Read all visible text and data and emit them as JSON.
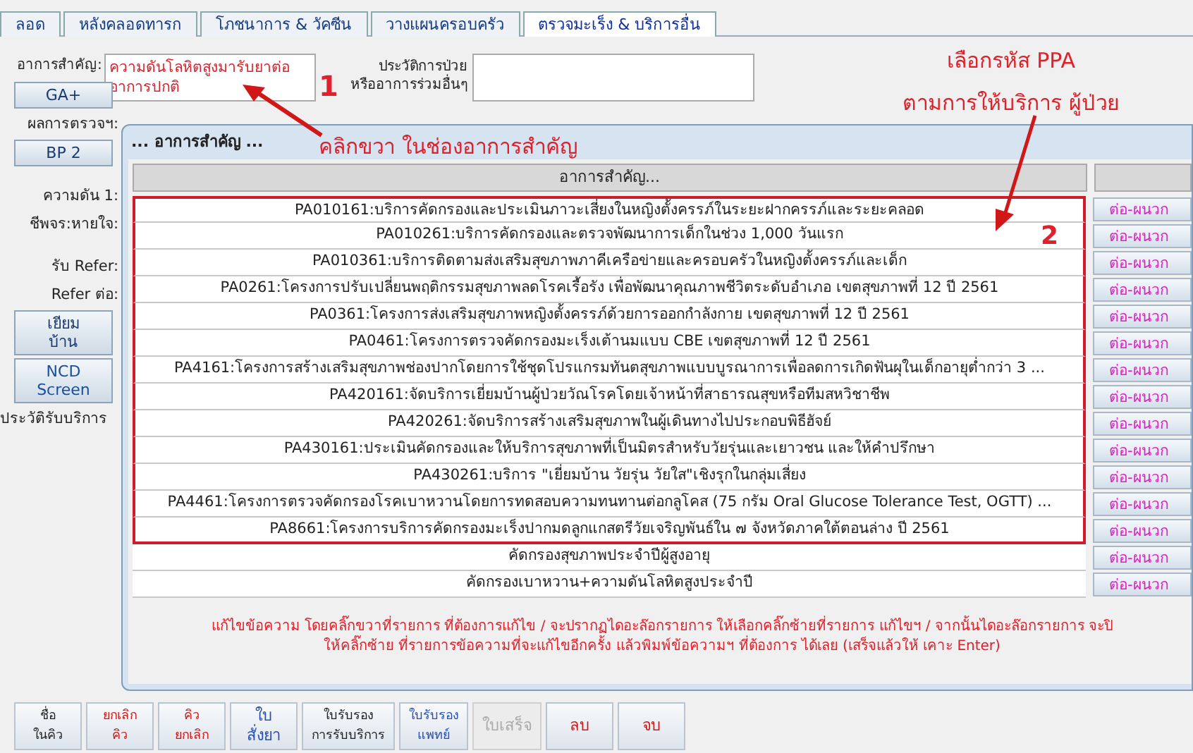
{
  "tabs": [
    {
      "label": "ลอด",
      "selected": false
    },
    {
      "label": "หลังคลอดทารก",
      "selected": false
    },
    {
      "label": "โภชนาการ & วัคซีน",
      "selected": false
    },
    {
      "label": "วางแผนครอบครัว",
      "selected": false
    },
    {
      "label": "ตรวจมะเร็ง & บริการอื่น",
      "selected": true
    }
  ],
  "chief_complaint": {
    "label": "อาการสำคัญ:",
    "value_lines": [
      "ความดันโลหิตสูงมารับยาต่อ",
      "อาการปกติ"
    ]
  },
  "history": {
    "label_lines": [
      "ประวัติการป่วย",
      "หรืออาการร่วมอื่นๆ"
    ]
  },
  "left_panel": [
    {
      "kind": "button",
      "lines": [
        "GA+"
      ]
    },
    {
      "kind": "label",
      "lines": [
        "ผลการตรวจฯ:"
      ]
    },
    {
      "kind": "button",
      "lines": [
        "BP 2"
      ]
    },
    {
      "kind": "label",
      "lines": [
        "ความดัน 1:"
      ]
    },
    {
      "kind": "label",
      "lines": [
        "ชีพจร:หายใจ:"
      ]
    },
    {
      "kind": "label",
      "lines": [
        "รับ Refer:"
      ]
    },
    {
      "kind": "label",
      "lines": [
        "Refer ต่อ:"
      ]
    },
    {
      "kind": "button",
      "lines": [
        "เยียม",
        "บ้าน"
      ]
    },
    {
      "kind": "blue_button",
      "lines": [
        "NCD",
        "Screen"
      ]
    },
    {
      "kind": "label",
      "lines": [
        "ประวัติรับบริการ"
      ]
    }
  ],
  "dialog": {
    "title": "... อาการสำคัญ ...",
    "column_header": "อาการสำคัญ...",
    "rows": [
      {
        "text": "PA010161:บริการคัดกรองและประเมินภาวะเสี่ยงในหญิงตั้งครรภ์ในระยะฝากครรภ์และระยะคลอด",
        "action": "ต่อ-ผนวก",
        "outlined": true
      },
      {
        "text": "PA010261:บริการคัดกรองและตรวจพัฒนาการเด็กในช่วง 1,000 วันแรก",
        "action": "ต่อ-ผนวก",
        "outlined": true
      },
      {
        "text": "PA010361:บริการติดตามส่งเสริมสุขภาพภาคีเครือข่ายและครอบครัวในหญิงตั้งครรภ์และเด็ก",
        "action": "ต่อ-ผนวก",
        "outlined": true
      },
      {
        "text": "PA0261:โครงการปรับเปลี่ยนพฤติกรรมสุขภาพลดโรคเรื้อรัง เพื่อพัฒนาคุณภาพชีวิตระดับอำเภอ เขตสุขภาพที่ 12 ปี 2561",
        "action": "ต่อ-ผนวก",
        "outlined": true
      },
      {
        "text": "PA0361:โครงการส่งเสริมสุขภาพหญิงตั้งครรภ์ด้วยการออกกำลังกาย เขตสุขภาพที่ 12 ปี 2561",
        "action": "ต่อ-ผนวก",
        "outlined": true
      },
      {
        "text": "PA0461:โครงการตรวจคัดกรองมะเร็งเต้านมแบบ CBE เขตสุขภาพที่ 12 ปี 2561",
        "action": "ต่อ-ผนวก",
        "outlined": true
      },
      {
        "text": "PA4161:โครงการสร้างเสริมสุขภาพช่องปากโดยการใช้ชุดโปรแกรมทันตสุขภาพแบบบูรณาการเพื่อลดการเกิดฟันผุในเด็กอายุต่ำกว่า 3 ...",
        "action": "ต่อ-ผนวก",
        "outlined": true
      },
      {
        "text": "PA420161:จัดบริการเยี่ยมบ้านผู้ป่วยวัณโรคโดยเจ้าหน้าที่สาธารณสุขหรือทีมสหวิชาชีพ",
        "action": "ต่อ-ผนวก",
        "outlined": true
      },
      {
        "text": "PA420261:จัดบริการสร้างเสริมสุขภาพในผู้เดินทางไปประกอบพิธีฮัจย์",
        "action": "ต่อ-ผนวก",
        "outlined": true
      },
      {
        "text": "PA430161:ประเมินคัดกรองและให้บริการสุขภาพที่เป็นมิตรสำหรับวัยรุ่นและเยาวชน และให้คำปรึกษา",
        "action": "ต่อ-ผนวก",
        "outlined": true
      },
      {
        "text": "PA430261:บริการ \"เยี่ยมบ้าน วัยรุ่น วัยใส\"เชิงรุกในกลุ่มเสี่ยง",
        "action": "ต่อ-ผนวก",
        "outlined": true
      },
      {
        "text": "PA4461:โครงการตรวจคัดกรองโรคเบาหวานโดยการทดสอบความทนทานต่อกลูโคส (75 กรัม Oral Glucose Tolerance Test, OGTT) ...",
        "action": "ต่อ-ผนวก",
        "outlined": true
      },
      {
        "text": "PA8661:โครงการบริการคัดกรองมะเร็งปากมดลูกแกสตรีวัยเจริญพันธ์ใน ๗ จังหวัดภาคใต้ตอนล่าง ปี 2561",
        "action": "ต่อ-ผนวก",
        "outlined": true
      },
      {
        "text": "คัดกรองสุขภาพประจำปีผู้สูงอายุ",
        "action": "ต่อ-ผนวก",
        "outlined": false
      },
      {
        "text": "คัดกรองเบาหวาน+ความดันโลหิตสูงประจำปี",
        "action": "ต่อ-ผนวก",
        "outlined": false
      }
    ],
    "instructions": [
      "แก้ไขข้อความ โดยคลิ๊กขวาที่รายการ ที่ต้องการแก้ไข / จะปรากฏไดอะล๊อกรายการ ให้เลือกคลิ๊กซ้ายที่รายการ แก้ไขฯ / จากนั้นไดอะล๊อกรายการ จะปิ",
      "ให้คลิ๊กซ้าย ที่รายการข้อความที่จะแก้ไขอีกครั้ง แล้วพิมพ์ข้อความฯ ที่ต้องการ ได้เลย (เสร็จแล้วให้ เคาะ Enter)"
    ]
  },
  "bottom_buttons": [
    {
      "lines": [
        "ชื่อ",
        "ในคิว"
      ],
      "color": "#222222",
      "disabled": false
    },
    {
      "lines": [
        "ยกเลิก",
        "คิว"
      ],
      "color": "#d01818",
      "disabled": false
    },
    {
      "lines": [
        "คิว",
        "ยกเลิก"
      ],
      "color": "#d01818",
      "disabled": false
    },
    {
      "lines": [
        "ใบ",
        "สั่งยา"
      ],
      "color": "#2a4fb0",
      "disabled": false
    },
    {
      "lines": [
        "ใบรับรอง",
        "การรับบริการ"
      ],
      "color": "#222222",
      "disabled": false
    },
    {
      "lines": [
        "ใบรับรอง",
        "แพทย์"
      ],
      "color": "#2a4fb0",
      "disabled": false
    },
    {
      "lines": [
        "ใบเสร็จ"
      ],
      "color": "#aaaaaa",
      "disabled": true
    },
    {
      "lines": [
        "ลบ"
      ],
      "color": "#d01818",
      "disabled": false
    },
    {
      "lines": [
        "จบ"
      ],
      "color": "#d01818",
      "disabled": false
    }
  ],
  "annotations": {
    "marker_1": "1",
    "right_click_note": "คลิกขวา ในช่องอาการสำคัญ",
    "ppa_note_lines": [
      "เลือกรหัส PPA",
      "ตามการให้บริการ ผู้ป่วย"
    ],
    "marker_2": "2"
  }
}
